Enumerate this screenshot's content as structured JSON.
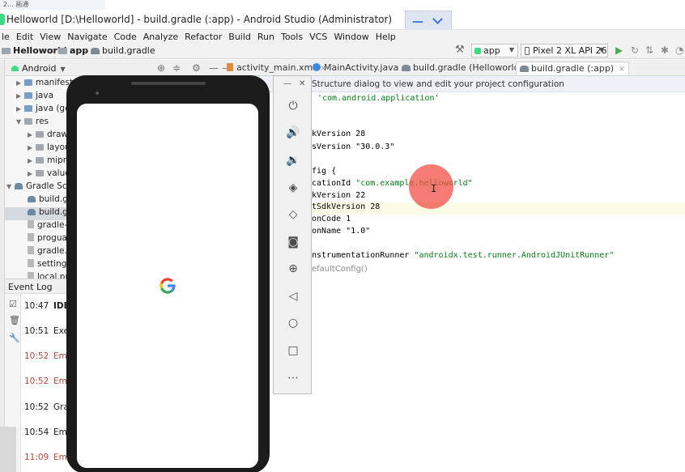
{
  "top_strip": {
    "text": "2...  画通"
  },
  "title_bar": {
    "title": "Helloworld [D:\\Helloworld] - build.gradle (:app) - Android Studio (Administrator)"
  },
  "menu": [
    "le",
    "Edit",
    "View",
    "Navigate",
    "Code",
    "Analyze",
    "Refactor",
    "Build",
    "Run",
    "Tools",
    "VCS",
    "Window",
    "Help"
  ],
  "nav": {
    "project": "Helloworld",
    "module": "app",
    "file": "build.gradle",
    "run_config": "app",
    "device": "Pixel 2 XL API 26"
  },
  "project_panel": {
    "view_selector": "Android",
    "tree": [
      {
        "label": "manifests",
        "icon": "folder-blue",
        "arrow": "▶"
      },
      {
        "label": "java",
        "icon": "folder-blue",
        "arrow": "▶"
      },
      {
        "label": "java (ge",
        "icon": "folder-blue",
        "arrow": "▶"
      },
      {
        "label": "res",
        "icon": "folder-gray",
        "arrow": "▼"
      },
      {
        "label": "draw",
        "icon": "folder-gray",
        "arrow": "▶"
      },
      {
        "label": "layou",
        "icon": "folder-gray",
        "arrow": "▶"
      },
      {
        "label": "mipm",
        "icon": "folder-gray",
        "arrow": "▶"
      },
      {
        "label": "value",
        "icon": "folder-gray",
        "arrow": "▶"
      },
      {
        "label": "Gradle Scri",
        "icon": "gradle",
        "arrow": "▼"
      },
      {
        "label": "build.gr",
        "icon": "gradle",
        "arrow": ""
      },
      {
        "label": "build.gr",
        "icon": "gradle",
        "arrow": ""
      },
      {
        "label": "gradle-",
        "icon": "file",
        "arrow": ""
      },
      {
        "label": "proguar",
        "icon": "file",
        "arrow": ""
      },
      {
        "label": "gradle.p",
        "icon": "file",
        "arrow": ""
      },
      {
        "label": "settings",
        "icon": "file",
        "arrow": ""
      },
      {
        "label": "local.pro",
        "icon": "file",
        "arrow": ""
      }
    ]
  },
  "event_log": {
    "title": "Event Log",
    "rows": [
      {
        "time": "10:47",
        "text": "IDE",
        "level": "info"
      },
      {
        "time": "10:51",
        "text": "Exe",
        "level": "info"
      },
      {
        "time": "10:52",
        "text": "Emu",
        "level": "error"
      },
      {
        "time": "10:52",
        "text": "Emu",
        "level": "error"
      },
      {
        "time": "10:52",
        "text": "Gra",
        "level": "info"
      },
      {
        "time": "10:54",
        "text": "Emu",
        "level": "info"
      },
      {
        "time": "11:09",
        "text": "Emu",
        "level": "error"
      }
    ]
  },
  "editor_tabs": [
    {
      "label": "activity_main.xml",
      "icon": "xml"
    },
    {
      "label": "MainActivity.java",
      "icon": "java"
    },
    {
      "label": "build.gradle (Helloworld)",
      "icon": "gradle"
    },
    {
      "label": "build.gradle (:app)",
      "icon": "gradle",
      "active": true
    }
  ],
  "editor": {
    "banner": "Structure dialog to view and edit your project configuration",
    "lines": {
      "plugin": "'com.android.application'",
      "compile_sdk": "kVersion 28",
      "build_tools": "sVersion \"30.0.3\"",
      "default_config": "fig {",
      "app_id_key": "cationId ",
      "app_id_val": "\"com.example.helloworld\"",
      "min_sdk": "kVersion 22",
      "target_sdk": "tSdkVersion 28",
      "version_code": "onCode 1",
      "version_name": "onName \"1.0\"",
      "runner_key": "nstrumentationRunner ",
      "runner_val": "\"androidx.test.runner.AndroidJUnitRunner\"",
      "hint": "efaultConfig()"
    }
  },
  "emulator": {
    "controls": [
      "power-icon",
      "volume-up-icon",
      "volume-down-icon",
      "rotate-left-icon",
      "rotate-right-icon",
      "camera-icon",
      "zoom-icon",
      "back-icon",
      "home-icon",
      "overview-icon",
      "more-icon"
    ]
  }
}
